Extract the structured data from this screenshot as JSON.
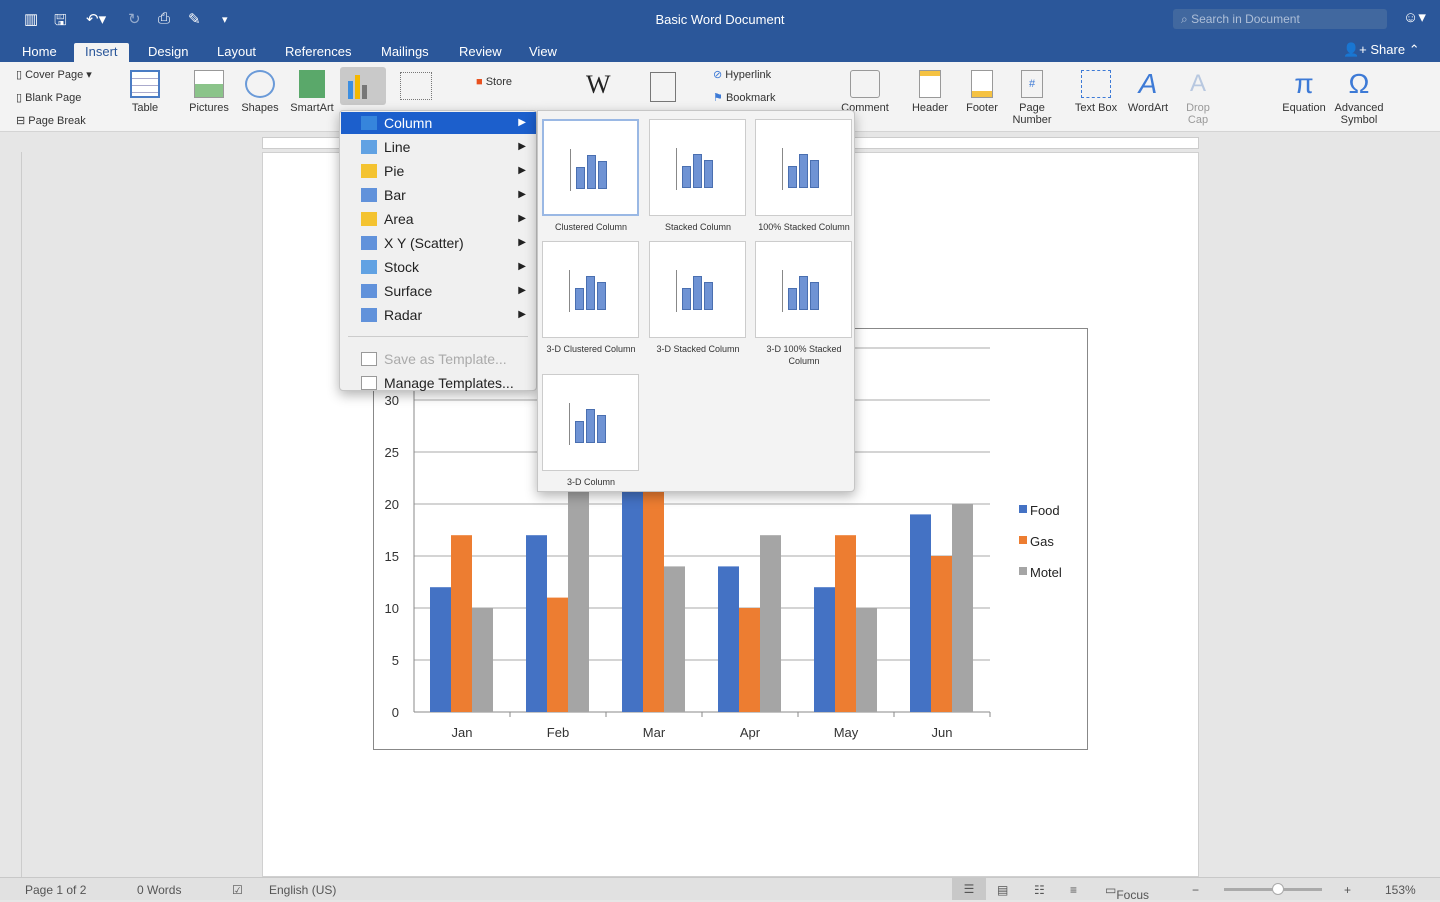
{
  "window": {
    "title": "Basic Word Document",
    "search_placeholder": "Search in Document",
    "share": "Share"
  },
  "tabs": [
    "Home",
    "Insert",
    "Design",
    "Layout",
    "References",
    "Mailings",
    "Review",
    "View"
  ],
  "active_tab": "Insert",
  "ribbon": {
    "pages": [
      "Cover Page",
      "Blank Page",
      "Page Break"
    ],
    "table": "Table",
    "pictures": "Pictures",
    "shapes": "Shapes",
    "smartart": "SmartArt",
    "store": "Store",
    "hyperlink": "Hyperlink",
    "bookmark": "Bookmark",
    "comment": "Comment",
    "header": "Header",
    "footer": "Footer",
    "page_number": "Page Number",
    "text_box": "Text Box",
    "wordart": "WordArt",
    "drop_cap": "Drop Cap",
    "equation": "Equation",
    "advanced_symbol": "Advanced Symbol"
  },
  "chart_menu": {
    "items": [
      "Column",
      "Line",
      "Pie",
      "Bar",
      "Area",
      "X Y (Scatter)",
      "Stock",
      "Surface",
      "Radar"
    ],
    "selected": "Column",
    "save_template": "Save as Template...",
    "manage_templates": "Manage Templates..."
  },
  "gallery": {
    "items": [
      "Clustered Column",
      "Stacked Column",
      "100% Stacked Column",
      "3-D Clustered Column",
      "3-D Stacked Column",
      "3-D 100% Stacked Column",
      "3-D Column"
    ],
    "selected": "Clustered Column"
  },
  "chart_data": {
    "type": "bar",
    "categories": [
      "Jan",
      "Feb",
      "Mar",
      "Apr",
      "May",
      "Jun"
    ],
    "series": [
      {
        "name": "Food",
        "color": "#4472c4",
        "values": [
          12,
          17,
          25,
          14,
          12,
          19
        ]
      },
      {
        "name": "Gas",
        "color": "#ed7d31",
        "values": [
          17,
          11,
          23,
          10,
          17,
          15
        ]
      },
      {
        "name": "Motel",
        "color": "#a5a5a5",
        "values": [
          10,
          22,
          14,
          17,
          10,
          20
        ]
      }
    ],
    "yticks": [
      0,
      5,
      10,
      15,
      20,
      25,
      30
    ],
    "ylim": [
      0,
      35
    ],
    "grid": true,
    "legend": "right"
  },
  "status": {
    "page": "Page 1 of 2",
    "words": "0 Words",
    "language": "English (US)",
    "focus": "Focus",
    "zoom": "153%"
  }
}
